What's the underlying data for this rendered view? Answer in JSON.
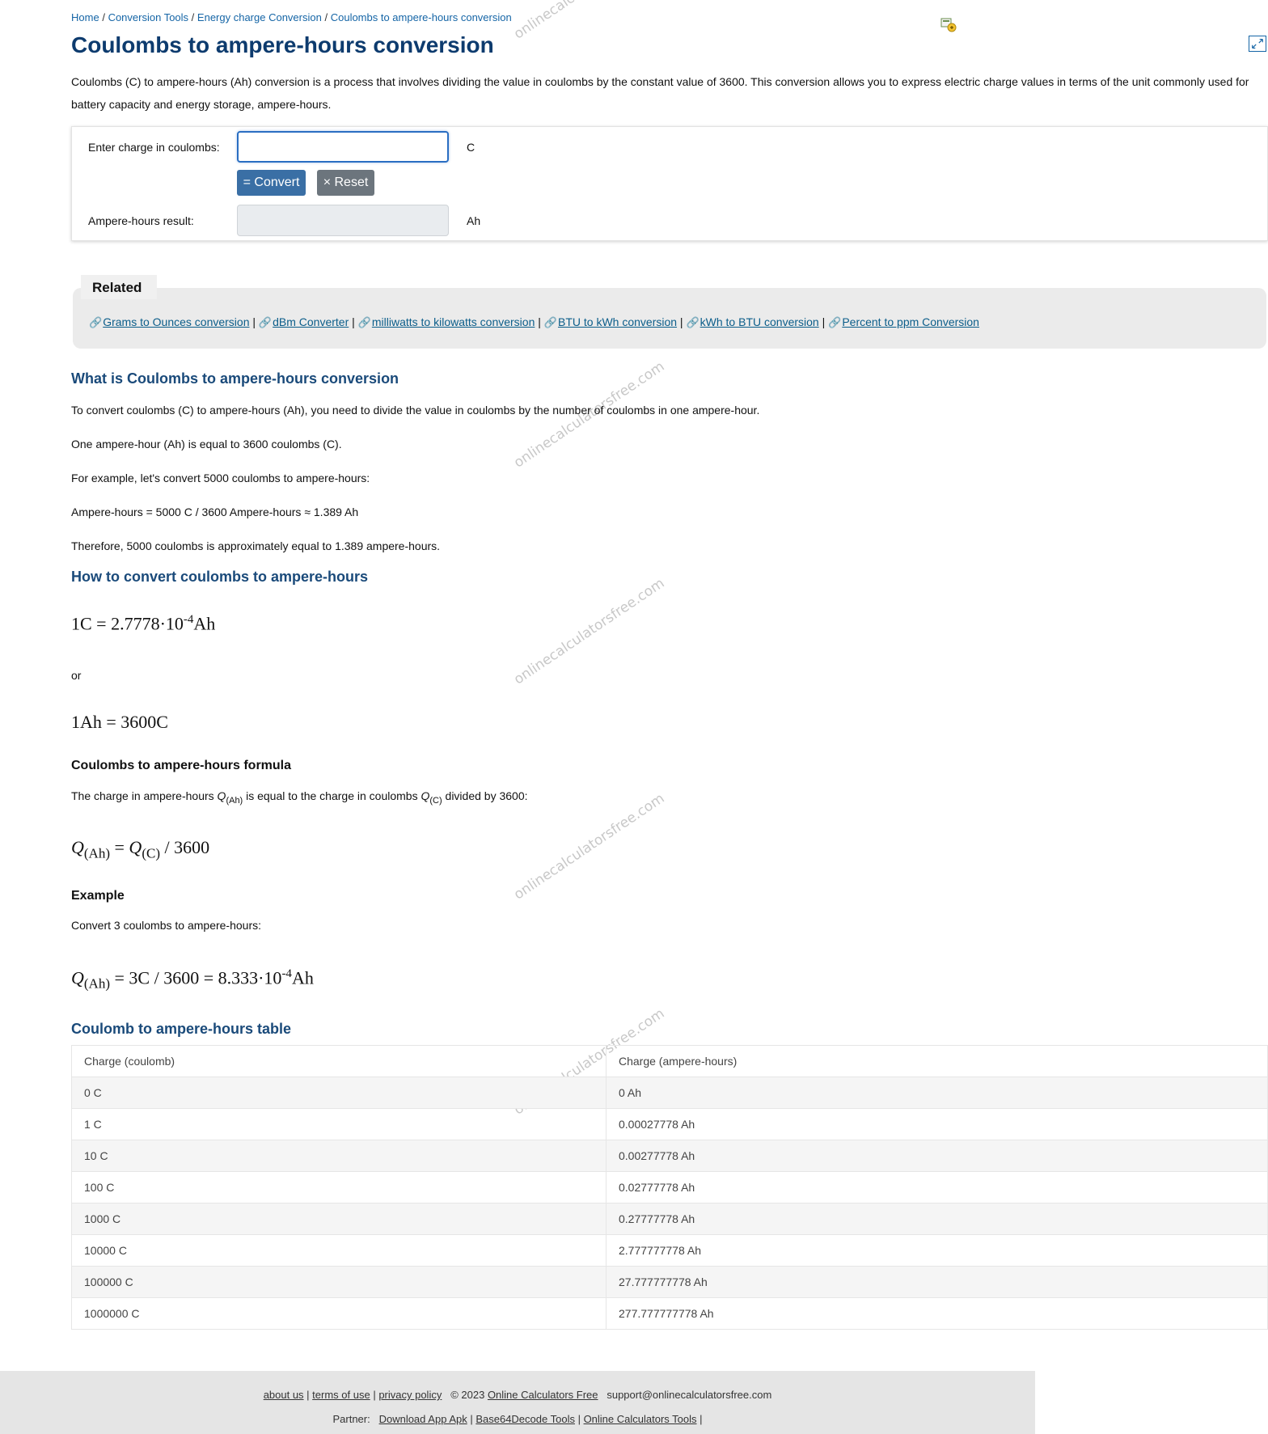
{
  "breadcrumb": {
    "items": [
      "Home",
      "Conversion Tools",
      "Energy charge Conversion",
      "Coulombs to ampere-hours conversion"
    ]
  },
  "title": "Coulombs to ampere-hours conversion",
  "intro": "Coulombs (C) to ampere-hours (Ah) conversion is a process that involves dividing the value in coulombs by the constant value of 3600. This conversion allows you to express electric charge values in terms of the unit commonly used for battery capacity and energy storage, ampere-hours.",
  "calculator": {
    "input_label": "Enter charge in coulombs:",
    "input_value": "",
    "input_unit": "C",
    "convert_label": "= Convert",
    "reset_label": "× Reset",
    "result_label": "Ampere-hours result:",
    "result_value": "",
    "result_unit": "Ah"
  },
  "related": {
    "title": "Related",
    "links": [
      "Grams to Ounces conversion",
      "dBm Converter",
      "milliwatts to kilowatts conversion",
      "BTU to kWh conversion",
      "kWh to BTU conversion",
      "Percent to ppm Conversion"
    ],
    "icon": "link-icon"
  },
  "article": {
    "what_heading": "What is Coulombs to ampere-hours conversion",
    "what_p1": "To convert coulombs (C) to ampere-hours (Ah), you need to divide the value in coulombs by the number of coulombs in one ampere-hour.",
    "what_p2": "One ampere-hour (Ah) is equal to 3600 coulombs (C).",
    "what_p3": "For example, let's convert 5000 coulombs to ampere-hours:",
    "what_p4": "Ampere-hours = 5000 C / 3600 Ampere-hours ≈ 1.389 Ah",
    "what_p5": "Therefore, 5000 coulombs is approximately equal to 1.389 ampere-hours.",
    "how_heading": "How to convert coulombs to ampere-hours",
    "eq1_left": "1C = 2.7778·10",
    "eq1_exp": "-4",
    "eq1_unit": "Ah",
    "or": "or",
    "eq2": "1Ah = 3600C",
    "formula_heading": "Coulombs to ampere-hours formula",
    "formula_text_a": "The charge in ampere-hours ",
    "formula_q": "Q",
    "formula_sub_ah": "(Ah)",
    "formula_text_b": " is equal to the charge in coulombs ",
    "formula_sub_c": "(C)",
    "formula_text_c": " divided by 3600:",
    "formula_eq_mid": " = ",
    "formula_eq_end": " / 3600",
    "example_heading": "Example",
    "example_text": "Convert 3 coulombs to ampere-hours:",
    "example_eq": " = 3C / 3600 = 8.333·10",
    "example_exp": "-4",
    "example_unit": "Ah",
    "table_heading": "Coulomb to ampere-hours table"
  },
  "table": {
    "headers": [
      "Charge (coulomb)",
      "Charge (ampere-hours)"
    ],
    "rows": [
      [
        "0 C",
        "0 Ah"
      ],
      [
        "1 C",
        "0.00027778 Ah"
      ],
      [
        "10 C",
        "0.00277778 Ah"
      ],
      [
        "100 C",
        "0.02777778 Ah"
      ],
      [
        "1000 C",
        "0.27777778 Ah"
      ],
      [
        "10000 C",
        "2.777777778 Ah"
      ],
      [
        "100000 C",
        "27.777777778 Ah"
      ],
      [
        "1000000 C",
        "277.777777778 Ah"
      ]
    ]
  },
  "watermark": "onlinecalculatorsfree.com",
  "footer": {
    "links": [
      "about us",
      "terms of use",
      "privacy policy"
    ],
    "copyright": "© 2023",
    "site_link": "Online Calculators Free",
    "email": "support@onlinecalculatorsfree.com",
    "partner_label": "Partner:",
    "partners": [
      "Download App Apk",
      "Base64Decode Tools",
      "Online Calculators Tools"
    ]
  }
}
